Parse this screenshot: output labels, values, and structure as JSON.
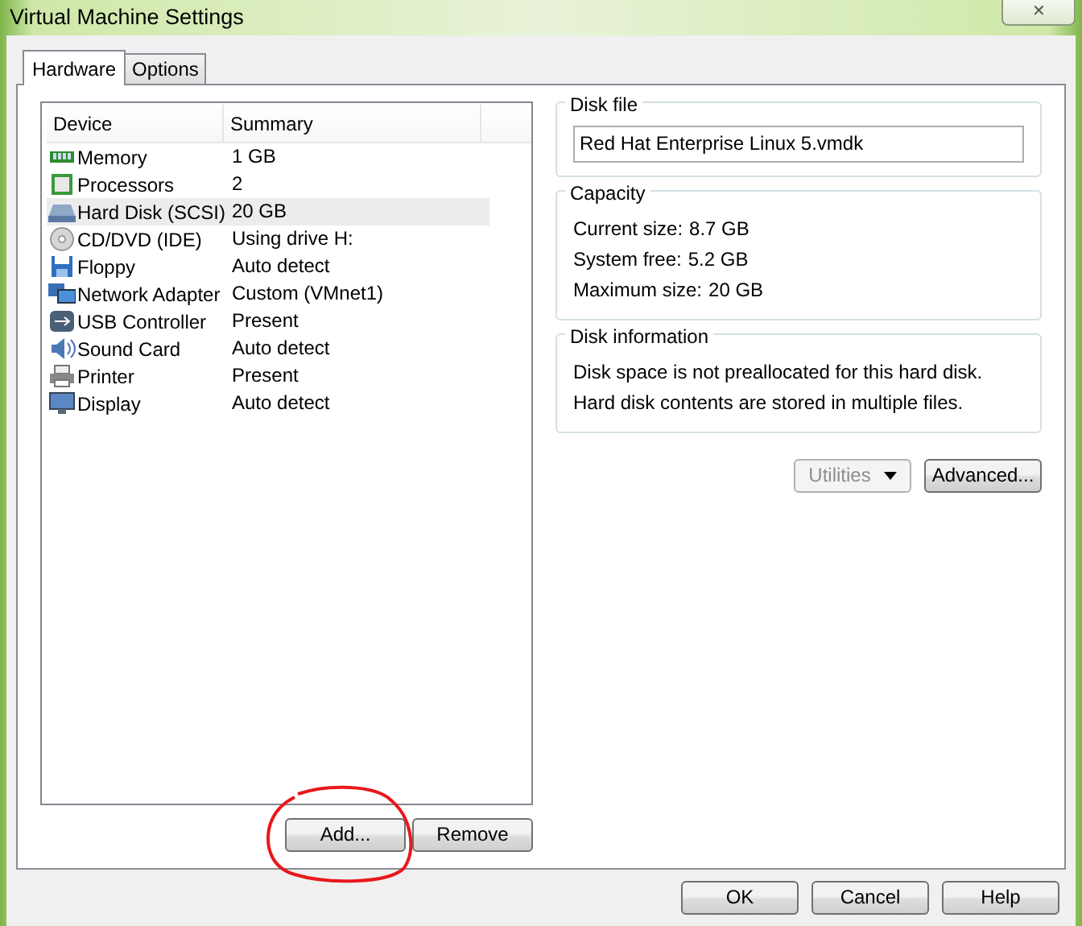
{
  "window": {
    "title": "Virtual Machine Settings",
    "close": "✕"
  },
  "tabs": [
    {
      "label": "Hardware",
      "selected": true
    },
    {
      "label": "Options",
      "selected": false
    }
  ],
  "devices": {
    "columns": [
      "Device",
      "Summary"
    ],
    "rows": [
      {
        "kind": "memory",
        "device": "Memory",
        "summary": "1 GB",
        "selected": false
      },
      {
        "kind": "processor",
        "device": "Processors",
        "summary": "2",
        "selected": false
      },
      {
        "kind": "disk",
        "device": "Hard Disk (SCSI)",
        "summary": "20 GB",
        "selected": true
      },
      {
        "kind": "cd",
        "device": "CD/DVD (IDE)",
        "summary": "Using drive H:",
        "selected": false
      },
      {
        "kind": "floppy",
        "device": "Floppy",
        "summary": "Auto detect",
        "selected": false
      },
      {
        "kind": "network",
        "device": "Network Adapter",
        "summary": "Custom (VMnet1)",
        "selected": false
      },
      {
        "kind": "usb",
        "device": "USB Controller",
        "summary": "Present",
        "selected": false
      },
      {
        "kind": "sound",
        "device": "Sound Card",
        "summary": "Auto detect",
        "selected": false
      },
      {
        "kind": "printer",
        "device": "Printer",
        "summary": "Present",
        "selected": false
      },
      {
        "kind": "display",
        "device": "Display",
        "summary": "Auto detect",
        "selected": false
      }
    ]
  },
  "list_buttons": [
    "Add...",
    "Remove"
  ],
  "disk_file": {
    "title": "Disk file",
    "value": "Red Hat Enterprise Linux 5.vmdk"
  },
  "capacity": {
    "title": "Capacity",
    "lines": [
      {
        "label": "Current size:",
        "value": "8.7 GB"
      },
      {
        "label": "System free:",
        "value": "5.2 GB"
      },
      {
        "label": "Maximum size:",
        "value": "20 GB"
      }
    ]
  },
  "disk_information": {
    "title": "Disk information",
    "lines": [
      "Disk space is not preallocated for this hard disk.",
      "Hard disk contents are stored in multiple files."
    ]
  },
  "disk_buttons": [
    {
      "label": "Utilities",
      "kind": "dropdown",
      "disabled": true
    },
    {
      "label": "Advanced...",
      "kind": "plain",
      "disabled": false
    }
  ],
  "dialog_buttons": [
    "OK",
    "Cancel",
    "Help"
  ]
}
